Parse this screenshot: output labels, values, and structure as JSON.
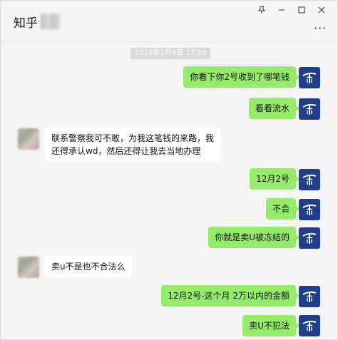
{
  "window": {
    "title": "知乎",
    "controls": {
      "pin_icon": "pin-icon",
      "minimize_icon": "minimize-icon",
      "maximize_icon": "maximize-icon",
      "close_icon": "close-icon"
    },
    "more_label": "···"
  },
  "chat": {
    "timestamp": "2023年1月4日 17:20",
    "messages": [
      {
        "sender": "me",
        "text": "你看下你2号收到了哪笔钱"
      },
      {
        "sender": "me",
        "text": "看看流水"
      },
      {
        "sender": "other",
        "text": "联系警察我可不敢，为我这笔钱的来路，我还得承认wd，然后还得让我去当地办理"
      },
      {
        "sender": "me",
        "text": "12月2号"
      },
      {
        "sender": "me",
        "text": "不会"
      },
      {
        "sender": "me",
        "text": "你就是卖U被冻结的"
      },
      {
        "sender": "other",
        "text": "卖u不是也不合法么"
      },
      {
        "sender": "me",
        "text": "12月2号-这个月 2万以内的金额"
      },
      {
        "sender": "me",
        "text": "卖U不犯法"
      }
    ]
  },
  "colors": {
    "my_bubble": "#95ec69",
    "other_bubble": "#ffffff",
    "background": "#f5f5f5",
    "my_avatar": "#1f3f8e"
  }
}
